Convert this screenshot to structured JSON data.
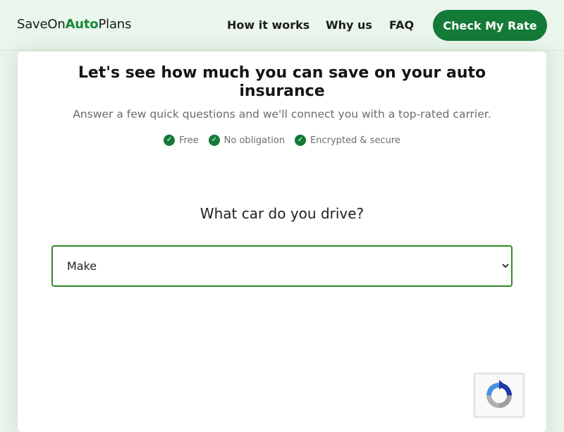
{
  "header": {
    "logo": {
      "part1": "SaveOn",
      "part2": "Auto",
      "part3": "Plans"
    },
    "nav": [
      "How it works",
      "Why us",
      "FAQ"
    ],
    "cta_label": "Check My Rate"
  },
  "main": {
    "title": "Let's see how much you can save on your auto insurance",
    "subtitle": "Answer a few quick questions and we'll connect you with a top-rated carrier.",
    "badges": [
      "Free",
      "No obligation",
      "Encrypted & secure"
    ],
    "question": "What car do you drive?",
    "make_select": {
      "value": "Make"
    }
  },
  "icons": {
    "badge": "check-circle-icon",
    "select": "chevron-down-icon",
    "captcha": "recaptcha-icon"
  },
  "colors": {
    "brand_green": "#137a37",
    "accent_green": "#178a38",
    "select_border": "#2e8a26",
    "page_background": "#e9f4ec"
  }
}
